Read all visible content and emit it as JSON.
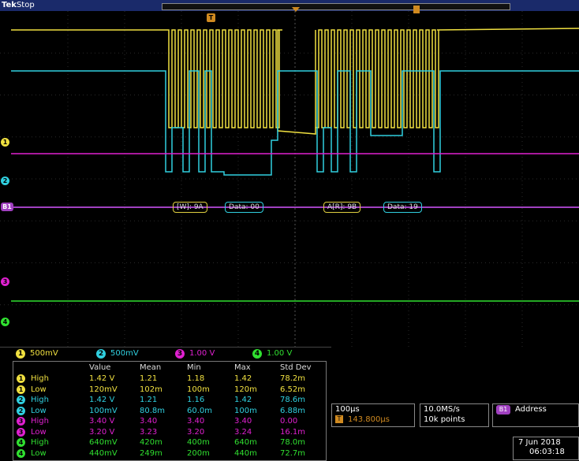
{
  "top_bar": {
    "brand": "Tek",
    "state": "Stop"
  },
  "markers": {
    "trigger_top": "T",
    "ch1": "1",
    "ch2": "2",
    "bus": "B1",
    "ch3": "3",
    "ch4": "4"
  },
  "bus": {
    "decode": [
      "[W]: 9A",
      "Data: 00",
      "A[R]: 9B",
      "Data: 19"
    ]
  },
  "channel_scales": [
    {
      "num": "1",
      "value": "500mV"
    },
    {
      "num": "2",
      "value": "500mV"
    },
    {
      "num": "3",
      "value": "1.00 V"
    },
    {
      "num": "4",
      "value": "1.00 V"
    }
  ],
  "measurements": {
    "headers": [
      "Value",
      "Mean",
      "Min",
      "Max",
      "Std Dev"
    ],
    "rows": [
      {
        "ch": "1",
        "name": "High",
        "values": [
          "1.42 V",
          "1.21",
          "1.18",
          "1.42",
          "78.2m"
        ]
      },
      {
        "ch": "1",
        "name": "Low",
        "values": [
          "120mV",
          "102m",
          "100m",
          "120m",
          "6.52m"
        ]
      },
      {
        "ch": "2",
        "name": "High",
        "values": [
          "1.42 V",
          "1.21",
          "1.16",
          "1.42",
          "78.6m"
        ]
      },
      {
        "ch": "2",
        "name": "Low",
        "values": [
          "100mV",
          "80.8m",
          "60.0m",
          "100m",
          "6.88m"
        ]
      },
      {
        "ch": "3",
        "name": "High",
        "values": [
          "3.40 V",
          "3.40",
          "3.40",
          "3.40",
          "0.00"
        ]
      },
      {
        "ch": "3",
        "name": "Low",
        "values": [
          "3.20 V",
          "3.23",
          "3.20",
          "3.24",
          "16.1m"
        ]
      },
      {
        "ch": "4",
        "name": "High",
        "values": [
          "640mV",
          "420m",
          "400m",
          "640m",
          "78.0m"
        ]
      },
      {
        "ch": "4",
        "name": "Low",
        "values": [
          "440mV",
          "249m",
          "200m",
          "440m",
          "72.7m"
        ]
      }
    ]
  },
  "timebase": {
    "scale": "100µs",
    "position": "143.800µs"
  },
  "acquisition": {
    "rate": "10.0MS/s",
    "points": "10k points"
  },
  "bus_status": {
    "icon": "B1",
    "label": "Address"
  },
  "datetime": {
    "date": "7 Jun 2018",
    "time": "06:03:18"
  },
  "colors": {
    "ch1": "#f0e040",
    "ch2": "#30d0e0",
    "ch3": "#e020d0",
    "ch4": "#30e030",
    "bus": "#a040c0"
  }
}
